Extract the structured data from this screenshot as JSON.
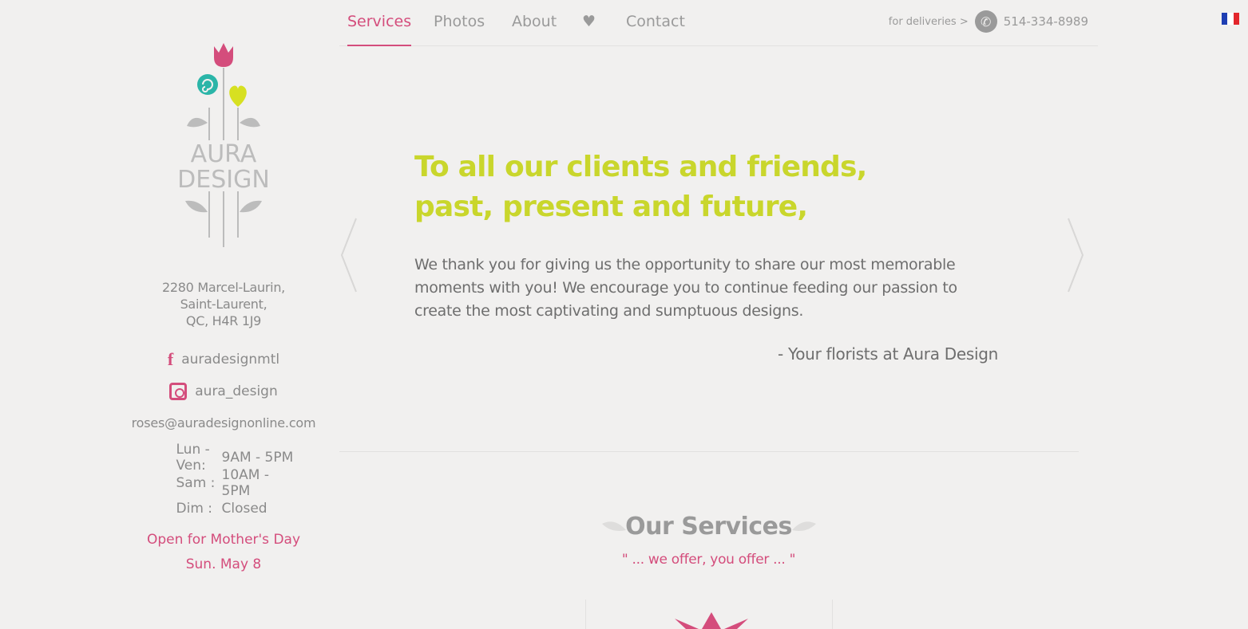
{
  "nav": {
    "items": [
      {
        "label": "Services",
        "active": true
      },
      {
        "label": "Photos",
        "active": false
      },
      {
        "label": "About",
        "active": false
      },
      {
        "label": "♥",
        "active": false
      },
      {
        "label": "Contact",
        "active": false
      }
    ],
    "delivery_label": "for deliveries >",
    "phone": "514-334-8989",
    "language_flag": "fr-flag-icon"
  },
  "brand": {
    "name_line1": "AURA",
    "name_line2": "DESIGN",
    "colors": {
      "pink": "#d44d7c",
      "teal": "#2bb5a8",
      "lime": "#c9d62c",
      "grey": "#bcbcbc"
    }
  },
  "sidebar": {
    "address": [
      "2280 Marcel-Laurin,",
      "Saint-Laurent,",
      "QC, H4R 1J9"
    ],
    "facebook": "auradesignmtl",
    "instagram": "aura_design",
    "email": "roses@auradesignonline.com",
    "hours": [
      {
        "day": "Lun - Ven:",
        "time": "9AM - 5PM"
      },
      {
        "day": "Sam :",
        "time": "10AM - 5PM"
      },
      {
        "day": "Dim :",
        "time": "Closed"
      }
    ],
    "notice_line1": "Open for Mother's Day",
    "notice_line2": "Sun. May 8"
  },
  "slide": {
    "headline_line1": "To all our clients and friends,",
    "headline_line2": "past, present and future,",
    "body": "We thank you for giving us the opportunity to share our most memorable moments with you! We encourage you to continue feeding our passion to create the most captivating and sumptuous designs.",
    "signature": "- Your florists at Aura Design"
  },
  "services": {
    "title": "Our Services",
    "subtitle": "\" ... we offer, you offer ... \""
  }
}
